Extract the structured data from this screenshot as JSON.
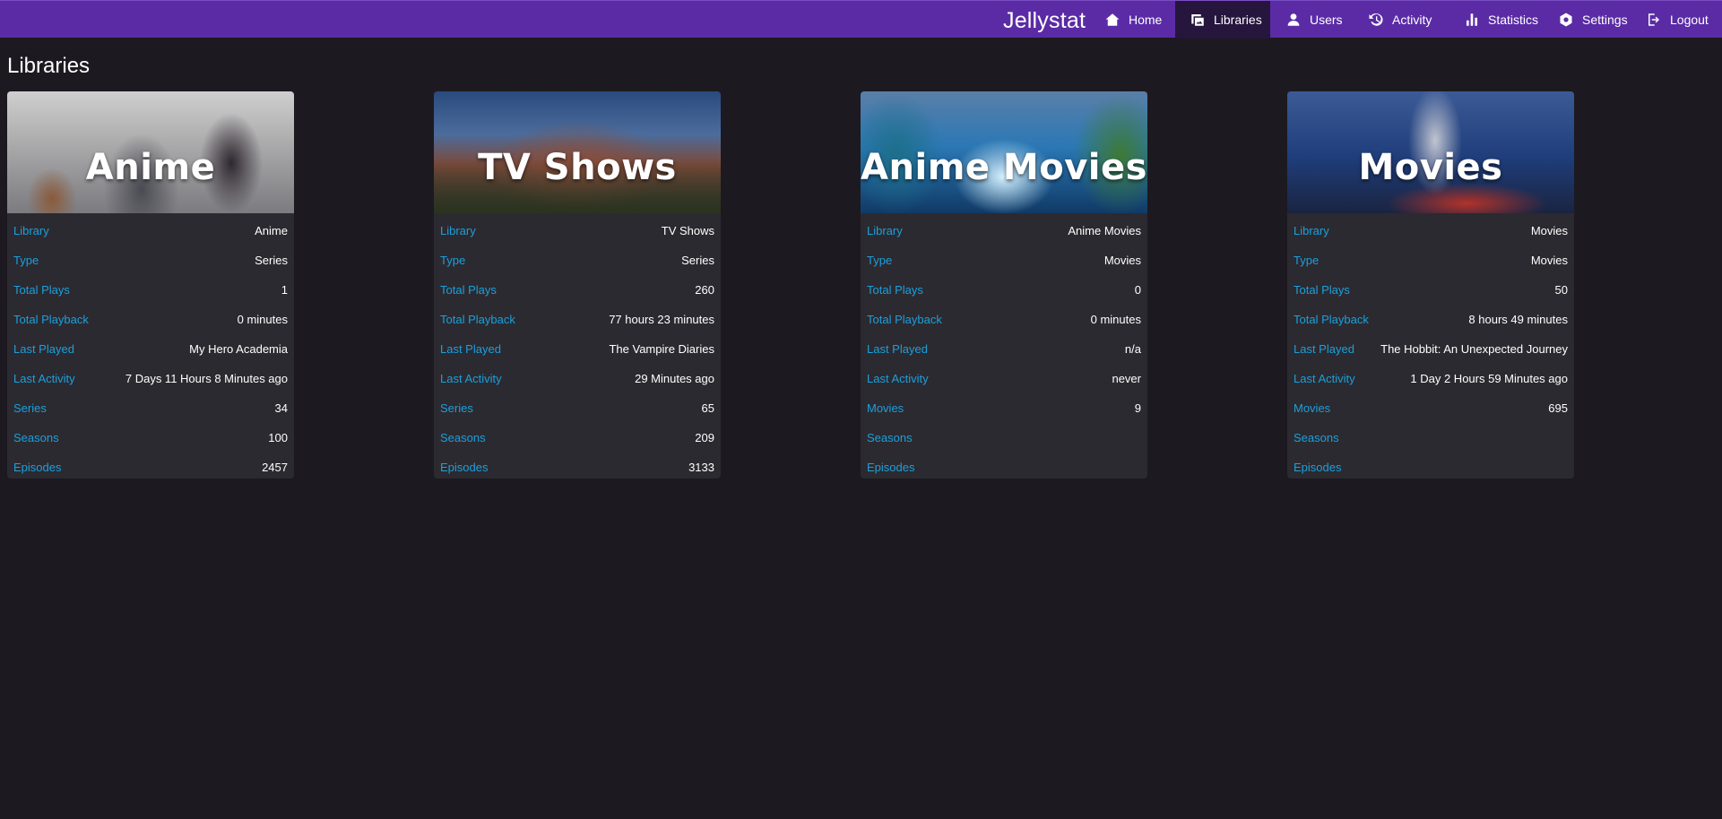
{
  "app": {
    "brand": "Jellystat"
  },
  "nav": {
    "home": "Home",
    "libraries": "Libraries",
    "users": "Users",
    "activity": "Activity",
    "statistics": "Statistics",
    "settings": "Settings",
    "logout": "Logout",
    "active": "Libraries"
  },
  "page": {
    "title": "Libraries"
  },
  "libraries": [
    {
      "banner_title": "Anime",
      "rows": [
        {
          "label": "Library",
          "value": "Anime"
        },
        {
          "label": "Type",
          "value": "Series"
        },
        {
          "label": "Total Plays",
          "value": "1"
        },
        {
          "label": "Total Playback",
          "value": "0 minutes"
        },
        {
          "label": "Last Played",
          "value": "My Hero Academia"
        },
        {
          "label": "Last Activity",
          "value": "7 Days 11 Hours 8 Minutes ago"
        },
        {
          "label": "Series",
          "value": "34"
        },
        {
          "label": "Seasons",
          "value": "100"
        },
        {
          "label": "Episodes",
          "value": "2457"
        }
      ]
    },
    {
      "banner_title": "TV Shows",
      "rows": [
        {
          "label": "Library",
          "value": "TV Shows"
        },
        {
          "label": "Type",
          "value": "Series"
        },
        {
          "label": "Total Plays",
          "value": "260"
        },
        {
          "label": "Total Playback",
          "value": "77 hours 23 minutes"
        },
        {
          "label": "Last Played",
          "value": "The Vampire Diaries"
        },
        {
          "label": "Last Activity",
          "value": "29 Minutes ago"
        },
        {
          "label": "Series",
          "value": "65"
        },
        {
          "label": "Seasons",
          "value": "209"
        },
        {
          "label": "Episodes",
          "value": "3133"
        }
      ]
    },
    {
      "banner_title": "Anime Movies",
      "rows": [
        {
          "label": "Library",
          "value": "Anime Movies"
        },
        {
          "label": "Type",
          "value": "Movies"
        },
        {
          "label": "Total Plays",
          "value": "0"
        },
        {
          "label": "Total Playback",
          "value": "0 minutes"
        },
        {
          "label": "Last Played",
          "value": "n/a"
        },
        {
          "label": "Last Activity",
          "value": "never"
        },
        {
          "label": "Movies",
          "value": "9"
        },
        {
          "label": "Seasons",
          "value": ""
        },
        {
          "label": "Episodes",
          "value": ""
        }
      ]
    },
    {
      "banner_title": "Movies",
      "rows": [
        {
          "label": "Library",
          "value": "Movies"
        },
        {
          "label": "Type",
          "value": "Movies"
        },
        {
          "label": "Total Plays",
          "value": "50"
        },
        {
          "label": "Total Playback",
          "value": "8 hours 49 minutes"
        },
        {
          "label": "Last Played",
          "value": "The Hobbit: An Unexpected Journey"
        },
        {
          "label": "Last Activity",
          "value": "1 Day 2 Hours 59 Minutes ago"
        },
        {
          "label": "Movies",
          "value": "695"
        },
        {
          "label": "Seasons",
          "value": ""
        },
        {
          "label": "Episodes",
          "value": ""
        }
      ]
    }
  ],
  "colors": {
    "nav_bg": "#5b2ba6",
    "nav_active_bg": "#26153d",
    "page_bg": "#1c1a20",
    "card_bg": "#2b2a30",
    "label_blue": "#1d9fdc"
  },
  "icons": {
    "home": "home-icon",
    "libraries": "libraries-icon",
    "users": "user-icon",
    "activity": "history-icon",
    "statistics": "bar-chart-icon",
    "settings": "gear-icon",
    "logout": "logout-icon"
  }
}
